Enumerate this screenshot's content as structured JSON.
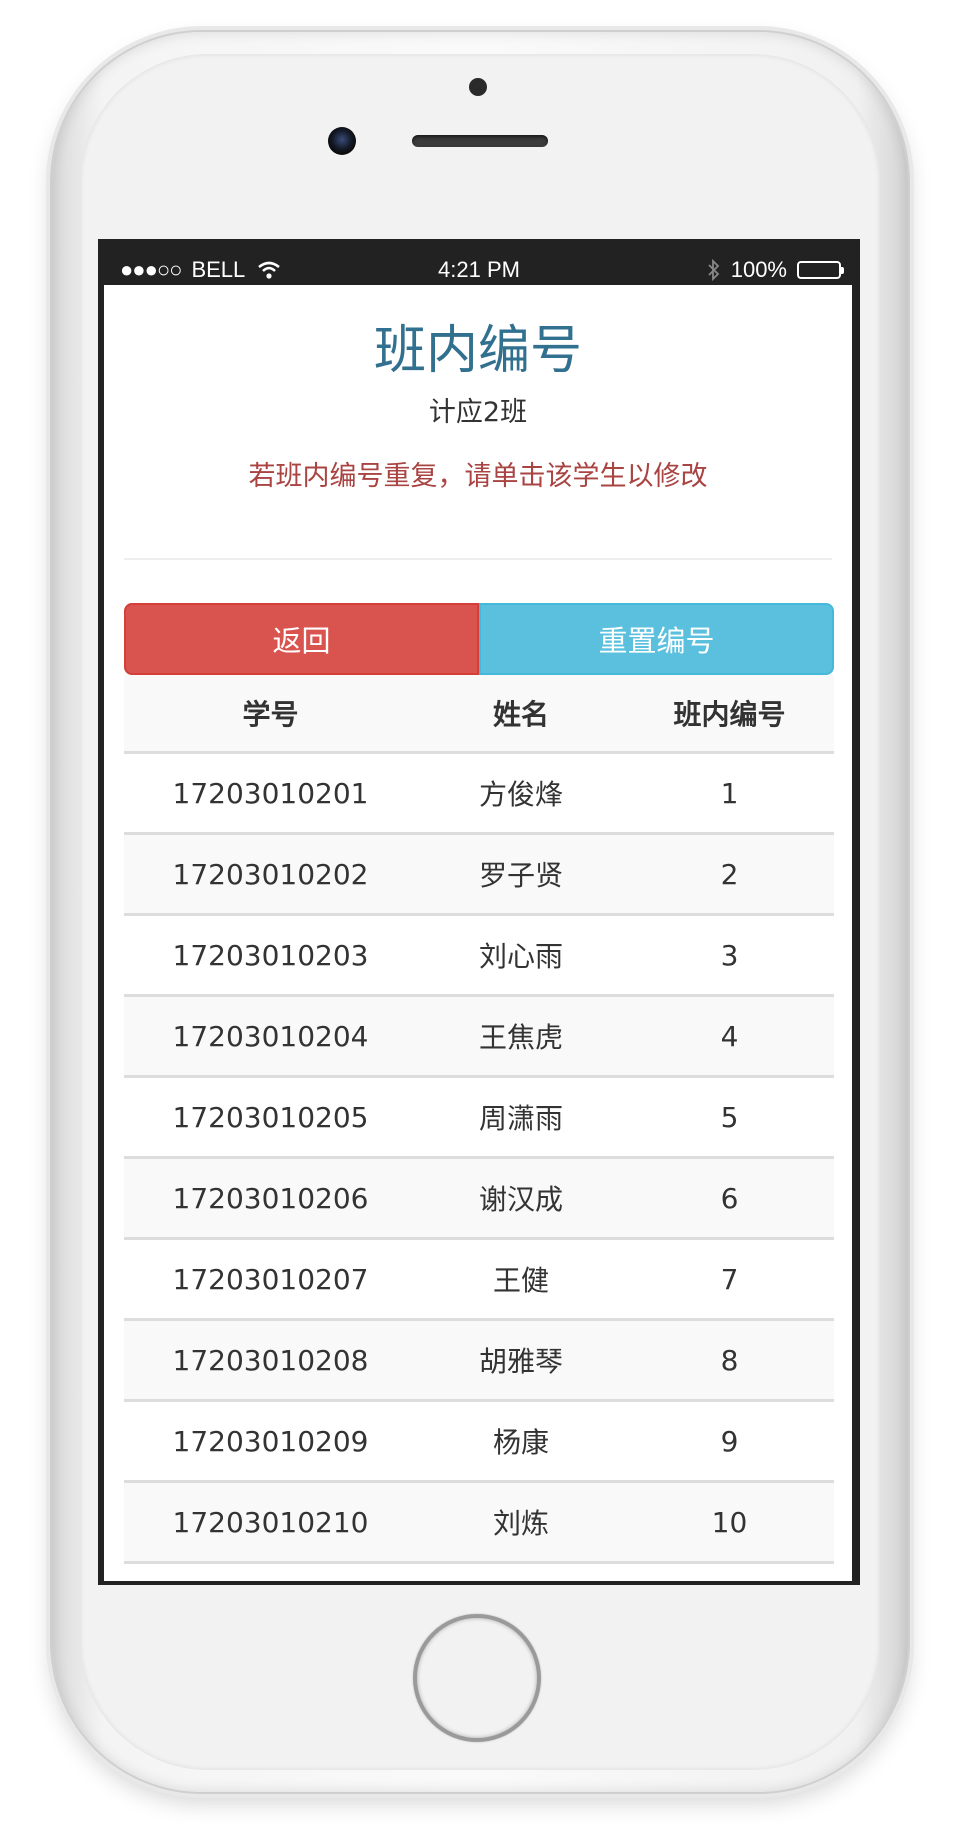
{
  "status_bar": {
    "signal": "●●●○○",
    "carrier": "BELL",
    "wifi_icon": "wifi-icon",
    "time": "4:21 PM",
    "bluetooth_icon": "bluetooth-icon",
    "battery_percent": "100%",
    "battery_level": 1.0
  },
  "header": {
    "title": "班内编号",
    "class_name": "计应2班",
    "hint": "若班内编号重复，请单击该学生以修改"
  },
  "buttons": {
    "back_label": "返回",
    "reset_label": "重置编号"
  },
  "colors": {
    "title": "#31708f",
    "hint": "#a94442",
    "back_button": "#d9534f",
    "reset_button": "#5bc0de"
  },
  "table": {
    "headers": [
      "学号",
      "姓名",
      "班内编号"
    ],
    "rows": [
      {
        "id": "17203010201",
        "name": "方俊烽",
        "number": "1"
      },
      {
        "id": "17203010202",
        "name": "罗子贤",
        "number": "2"
      },
      {
        "id": "17203010203",
        "name": "刘心雨",
        "number": "3"
      },
      {
        "id": "17203010204",
        "name": "王焦虎",
        "number": "4"
      },
      {
        "id": "17203010205",
        "name": "周潇雨",
        "number": "5"
      },
      {
        "id": "17203010206",
        "name": "谢汉成",
        "number": "6"
      },
      {
        "id": "17203010207",
        "name": "王健",
        "number": "7"
      },
      {
        "id": "17203010208",
        "name": "胡雅琴",
        "number": "8"
      },
      {
        "id": "17203010209",
        "name": "杨康",
        "number": "9"
      },
      {
        "id": "17203010210",
        "name": "刘炼",
        "number": "10"
      }
    ]
  }
}
